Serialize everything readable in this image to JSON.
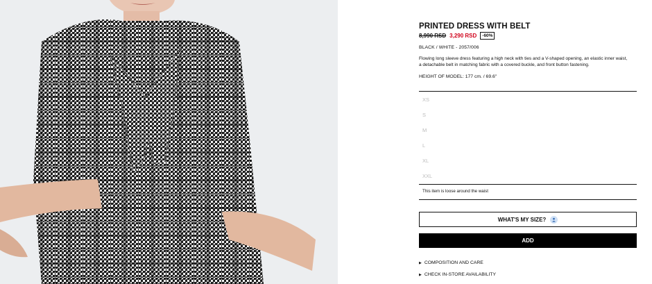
{
  "product": {
    "title": "PRINTED DRESS WITH BELT",
    "old_price": "8,990 RSD",
    "new_price": "3,290 RSD",
    "discount": "-60%",
    "color_ref": "BLACK / WHITE - 2057/006",
    "description": "Flowing long sleeve dress featuring a high neck with ties and a V-shaped opening, an elastic inner waist, a detachable belt in matching fabric with a covered buckle, and front button fastening.",
    "model_height": "HEIGHT OF MODEL: 177 cm. / 69.6\""
  },
  "sizes": [
    "XS",
    "S",
    "M",
    "L",
    "XL",
    "XXL"
  ],
  "fit_note": "This item is loose around the waist",
  "buttons": {
    "whats_my_size": "WHAT'S MY SIZE?",
    "add": "ADD"
  },
  "links": {
    "composition": "COMPOSITION AND CARE",
    "store": "CHECK IN-STORE AVAILABILITY"
  },
  "icons": {
    "size_icon": "person-icon",
    "expand_icon": "triangle-right-icon"
  },
  "colors": {
    "sale_red": "#d0021b",
    "text": "#111111",
    "size_disabled": "#bbbbbb"
  }
}
